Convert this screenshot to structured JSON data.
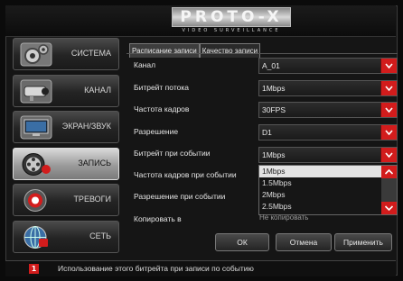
{
  "logo": {
    "brand": "PROTO-X",
    "tagline": "VIDEO SURVEILLANCE"
  },
  "sidebar": {
    "items": [
      {
        "label": "СИСТЕМА",
        "icon": "gear-icon"
      },
      {
        "label": "КАНАЛ",
        "icon": "camera-icon"
      },
      {
        "label": "ЭКРАН/ЗВУК",
        "icon": "monitor-icon"
      },
      {
        "label": "ЗАПИСЬ",
        "icon": "film-reel-icon",
        "active": true
      },
      {
        "label": "ТРЕВОГИ",
        "icon": "alarm-icon"
      },
      {
        "label": "СЕТЬ",
        "icon": "network-icon"
      }
    ]
  },
  "tabs": [
    {
      "label": "Расписание записи",
      "active": true
    },
    {
      "label": "Качество записи",
      "active": false
    }
  ],
  "form": {
    "rows": [
      {
        "label": "Канал",
        "value": "A_01"
      },
      {
        "label": "Битрейт потока",
        "value": "1Mbps"
      },
      {
        "label": "Частота кадров",
        "value": "30FPS"
      },
      {
        "label": "Разрешение",
        "value": "D1"
      },
      {
        "label": "Битрейт при событии",
        "value": "1Mbps"
      },
      {
        "label": "Частота  кадров при событии"
      },
      {
        "label": "Разрешение при событии"
      },
      {
        "label": "Копировать в",
        "value": "Не копировать"
      }
    ]
  },
  "dropdown": {
    "options": [
      "1Mbps",
      "1.5Mbps",
      "2Mbps",
      "2.5Mbps"
    ],
    "selected_index": 0
  },
  "buttons": {
    "ok": "ОК",
    "cancel": "Отмена",
    "apply": "Применить"
  },
  "status": {
    "icon_text": "1",
    "text": "Использование этого битрейта при записи по событию"
  },
  "colors": {
    "accent": "#d21c1c",
    "background": "#151515"
  }
}
